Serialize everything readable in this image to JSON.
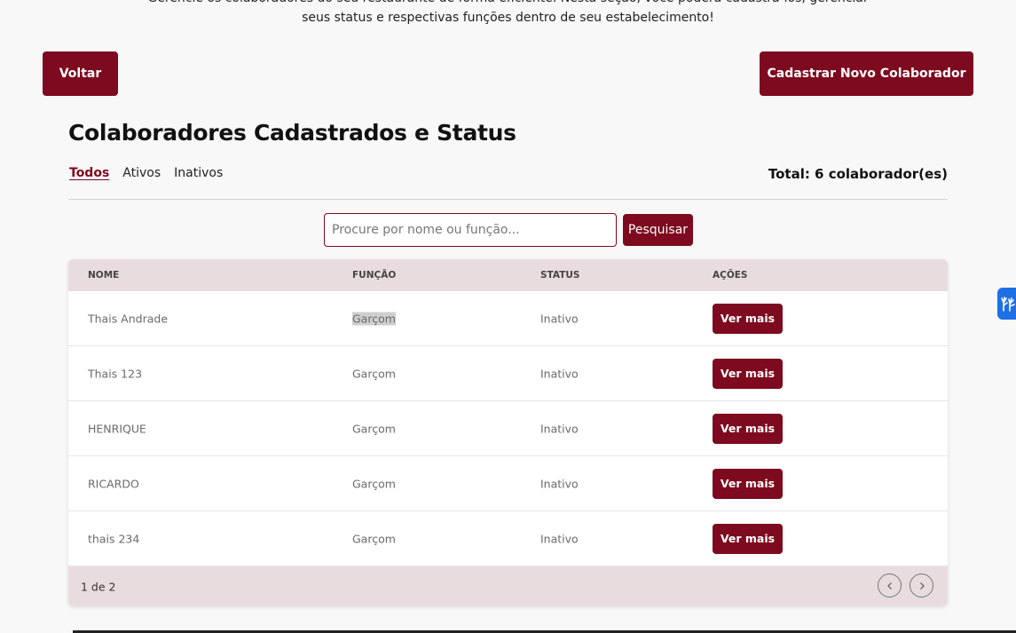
{
  "intro": {
    "line1": "Gerencie os colaboradores do seu restaurante de forma eficiente. Nesta seção, você poderá cadastrá-los, gerenciar",
    "line2": "seus status e respectivas funções dentro de seu estabelecimento!"
  },
  "buttons": {
    "back": "Voltar",
    "new_collaborator": "Cadastrar Novo Colaborador",
    "search": "Pesquisar"
  },
  "section": {
    "title": "Colaboradores Cadastrados e Status",
    "total": "Total: 6 colaborador(es)"
  },
  "filters": [
    "Todos",
    "Ativos",
    "Inativos"
  ],
  "active_filter": "Todos",
  "search": {
    "placeholder": "Procure por nome ou função...",
    "value": ""
  },
  "table": {
    "headers": [
      "NOME",
      "FUNÇÃO",
      "STATUS",
      "AÇÕES"
    ],
    "rows": [
      {
        "name": "Thais Andrade",
        "role": "Garçom",
        "status": "Inativo",
        "action": "Ver mais"
      },
      {
        "name": "Thais 123",
        "role": "Garçom",
        "status": "Inativo",
        "action": "Ver mais"
      },
      {
        "name": "HENRIQUE",
        "role": "Garçom",
        "status": "Inativo",
        "action": "Ver mais"
      },
      {
        "name": "RICARDO",
        "role": "Garçom",
        "status": "Inativo",
        "action": "Ver mais"
      },
      {
        "name": "thais 234",
        "role": "Garçom",
        "status": "Inativo",
        "action": "Ver mais"
      }
    ],
    "pagination": {
      "text": "1 de 2",
      "prev_icon": "chevron-left-icon",
      "next_icon": "chevron-right-icon"
    }
  },
  "colors": {
    "accent": "#7d0a1e",
    "table_header_bg": "#e9dcdf",
    "page_bg": "#f8f8f8",
    "accessibility_widget": "#1e6fe6"
  },
  "icons": {
    "accessibility": "sign-language-hands-icon"
  }
}
